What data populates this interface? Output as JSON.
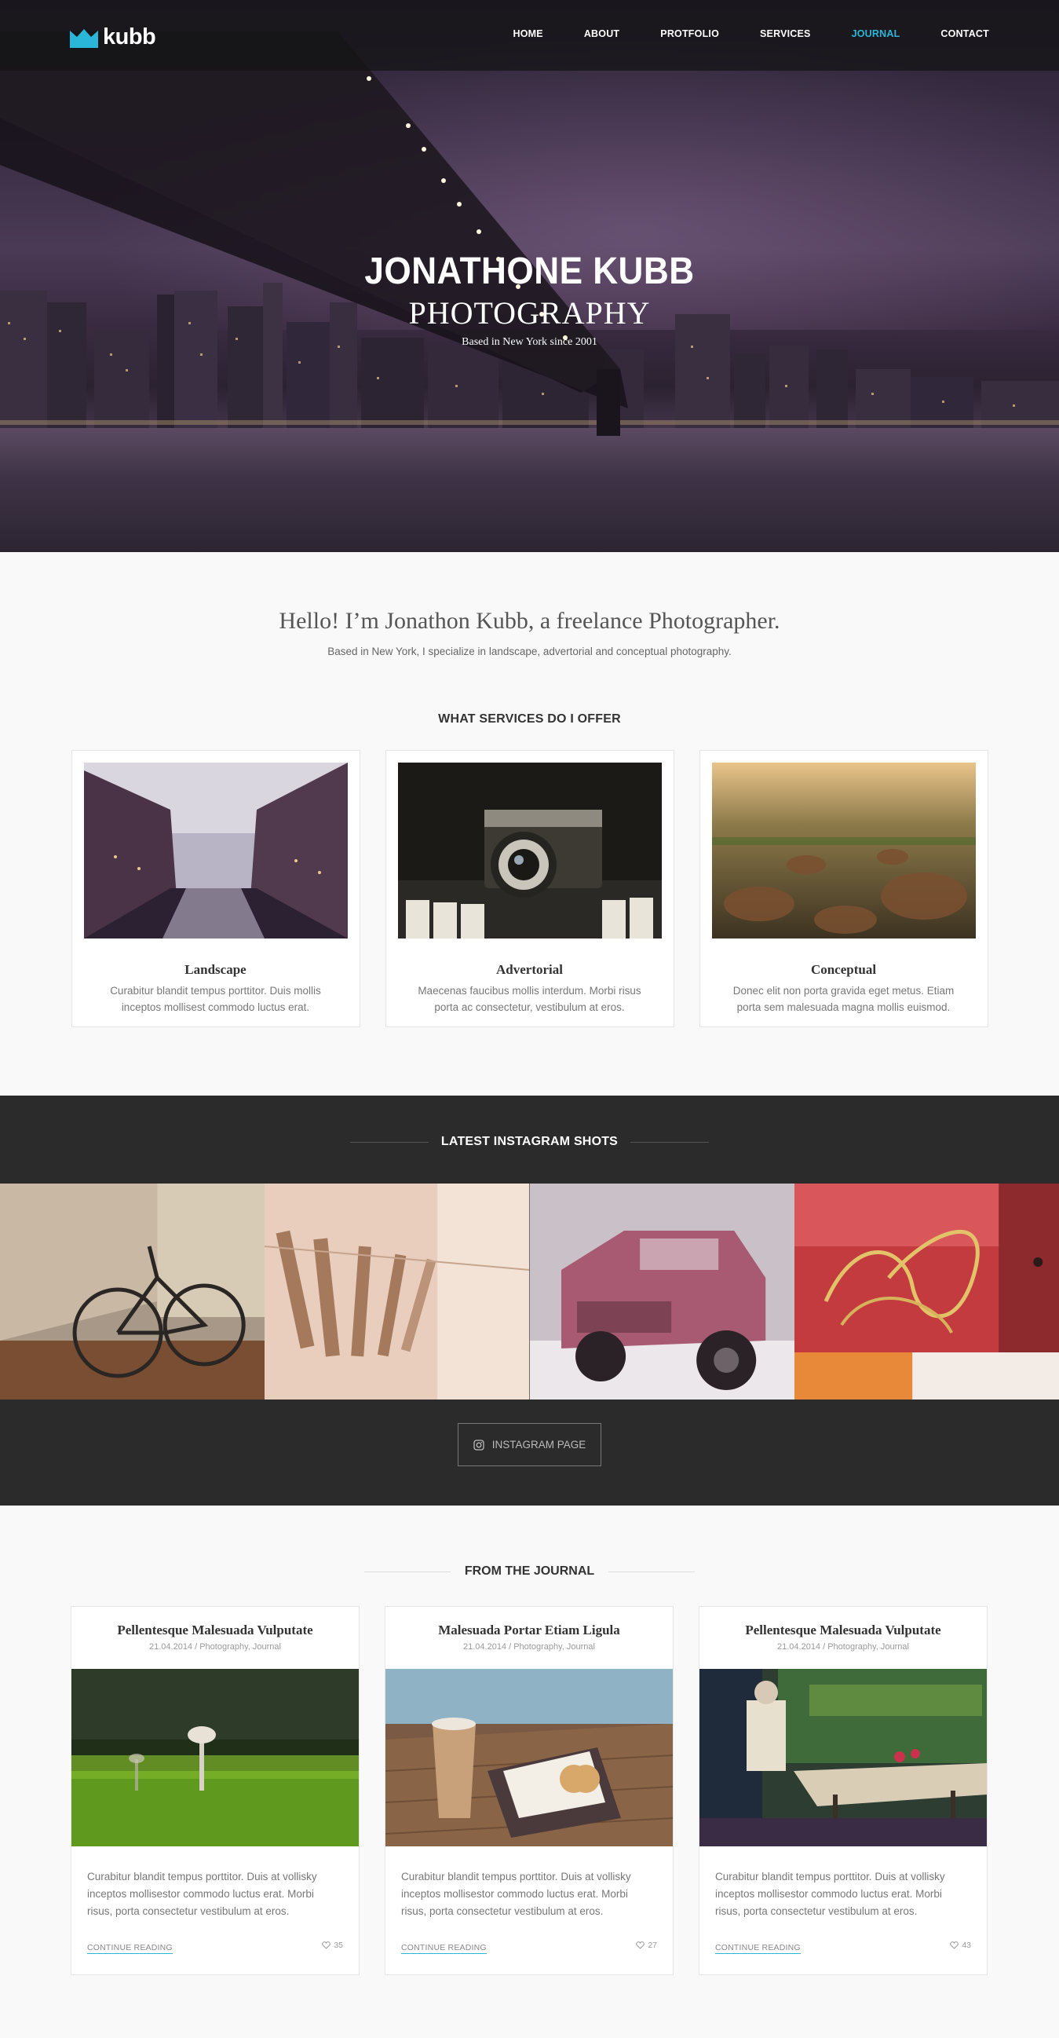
{
  "brand": {
    "logo_text": "kubb",
    "accent_color": "#29b6d8"
  },
  "nav": {
    "items": [
      {
        "label": "HOME",
        "active": false
      },
      {
        "label": "ABOUT",
        "active": false
      },
      {
        "label": "PROTFOLIO",
        "active": false
      },
      {
        "label": "SERVICES",
        "active": false
      },
      {
        "label": "JOURNAL",
        "active": true
      },
      {
        "label": "CONTACT",
        "active": false
      }
    ]
  },
  "hero": {
    "title": "JONATHONE KUBB",
    "subtitle": "PHOTOGRAPHY",
    "tagline": "Based in New York since 2001"
  },
  "intro": {
    "heading": "Hello! I’m Jonathon Kubb, a freelance Photographer.",
    "text": "Based in New York, I specialize in landscape, advertorial and conceptual photography."
  },
  "services": {
    "title": "WHAT SERVICES DO I OFFER",
    "items": [
      {
        "name": "Landscape",
        "desc": "Curabitur blandit tempus porttitor. Duis mollis inceptos mollisest commodo luctus erat."
      },
      {
        "name": "Advertorial",
        "desc": "Maecenas faucibus mollis interdum. Morbi risus porta ac consectetur, vestibulum at eros."
      },
      {
        "name": "Conceptual",
        "desc": "Donec elit non porta gravida eget metus. Etiam porta sem malesuada magna mollis euismod."
      }
    ]
  },
  "instagram": {
    "title": "LATEST INSTAGRAM SHOTS",
    "button_label": "INSTAGRAM PAGE"
  },
  "journal": {
    "title": "FROM THE JOURNAL",
    "posts": [
      {
        "title": "Pellentesque Malesuada Vulputate",
        "meta": "21.04.2014 / Photography, Journal",
        "excerpt": "Curabitur blandit tempus porttitor. Duis at vollisky inceptos mollisestor commodo luctus erat. Morbi risus, porta consectetur vestibulum at eros.",
        "more": "CONTINUE READING",
        "likes": "35"
      },
      {
        "title": "Malesuada Portar Etiam Ligula",
        "meta": "21.04.2014 / Photography, Journal",
        "excerpt": "Curabitur blandit tempus porttitor. Duis at vollisky inceptos mollisestor commodo luctus erat. Morbi risus, porta consectetur vestibulum at eros.",
        "more": "CONTINUE READING",
        "likes": "27"
      },
      {
        "title": "Pellentesque Malesuada Vulputate",
        "meta": "21.04.2014 / Photography, Journal",
        "excerpt": "Curabitur blandit tempus porttitor. Duis at vollisky inceptos mollisestor commodo luctus erat. Morbi risus, porta consectetur vestibulum at eros.",
        "more": "CONTINUE READING",
        "likes": "43"
      }
    ]
  }
}
